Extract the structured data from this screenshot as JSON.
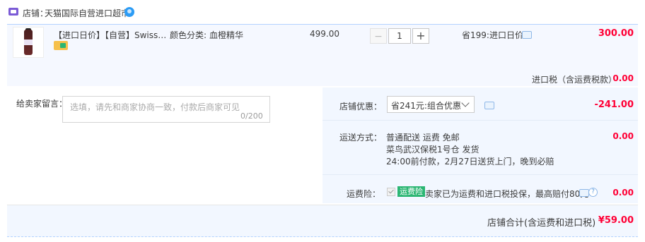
{
  "shop": {
    "label": "店铺：",
    "name": "天猫国际自营进口超市"
  },
  "item": {
    "title": "【进口日价】【自营】Swisse...",
    "sku_label": "颜色分类:",
    "sku_value": "血橙精华",
    "unit_price": "499.00",
    "qty_minus": "−",
    "quantity": "1",
    "qty_plus": "+",
    "promo": "省199:进口日价",
    "total": "300.00",
    "tax_label": "进口税（含运费税款）",
    "tax_value": "0.00"
  },
  "message": {
    "label": "给卖家留言：",
    "placeholder": "选填，请先和商家协商一致，付款后商家可见",
    "counter": "0/200"
  },
  "discount": {
    "label": "店铺优惠：",
    "selected": "省241元:组合优惠",
    "value": "-241.00"
  },
  "shipping": {
    "label": "运送方式：",
    "line1": "普通配送 运费 免邮",
    "line2": "菜鸟武汉保税1号仓  发货",
    "line3": "24:00前付款，2月27日送货上门，晚到必赔",
    "value": "0.00"
  },
  "insurance": {
    "label": "运费险：",
    "tag": "运费险",
    "text": "卖家已为运费和进口税投保，最高赔付80元",
    "help": "?",
    "value": "0.00"
  },
  "footer": {
    "label": "店铺合计(含运费和进口税)",
    "value": "¥59.00"
  },
  "colors": {
    "price_red": "#ff0036",
    "panel_blue": "#f2f7ff",
    "insurance_green": "#2bb673",
    "badge_blue": "#2d9cf5"
  },
  "icons": [
    "shop-icon",
    "verified-badge-icon",
    "product-thumbnail",
    "promo-tag-icon",
    "chat-icon",
    "caret-down-icon",
    "checkbox-icon",
    "help-icon"
  ]
}
